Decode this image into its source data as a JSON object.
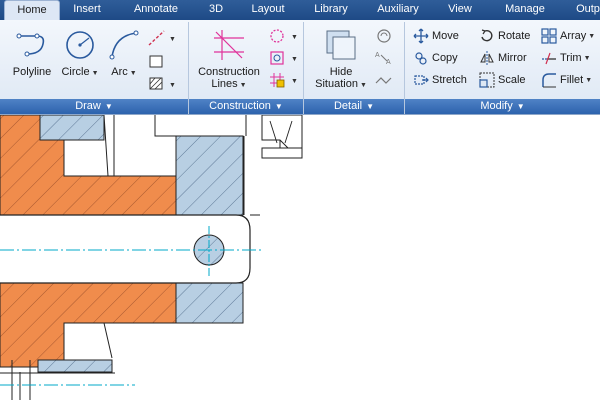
{
  "tabs": [
    "Home",
    "Insert",
    "Annotate",
    "3D",
    "Layout",
    "Library",
    "Auxiliary",
    "View",
    "Manage",
    "Outp"
  ],
  "draw": {
    "group_label": "Draw",
    "polyline": "Polyline",
    "circle": "Circle",
    "arc": "Arc"
  },
  "construction": {
    "group_label": "Construction",
    "lines_line1": "Construction",
    "lines_line2": "Lines"
  },
  "detail": {
    "group_label": "Detail",
    "hide_line1": "Hide",
    "hide_line2": "Situation"
  },
  "modify": {
    "group_label": "Modify",
    "move": "Move",
    "copy": "Copy",
    "stretch": "Stretch",
    "rotate": "Rotate",
    "mirror": "Mirror",
    "scale": "Scale",
    "array": "Array",
    "trim": "Trim",
    "fillet": "Fillet"
  },
  "colors": {
    "tabbar": "#1e4a86",
    "ribbon": "#dde7f4",
    "group_label_bar": "#2d63ad",
    "hatch_orange": "#f08c4c",
    "hatch_blue": "#b8cfe3",
    "centerline": "#00a8c8",
    "construction_magenta": "#e0329a"
  }
}
